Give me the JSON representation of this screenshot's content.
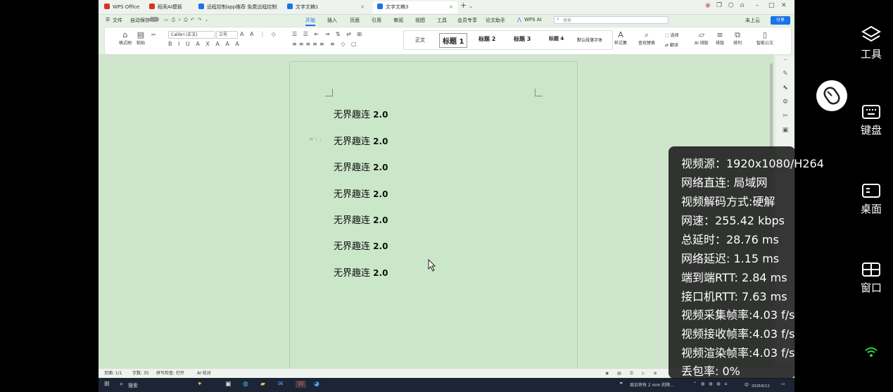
{
  "titlebar": {
    "tabs": [
      {
        "label": "WPS Office",
        "color": "#d93025"
      },
      {
        "label": "稻壳AI模板",
        "color": "#d93025"
      },
      {
        "label": "远程控制app推荐 免费远程控制软",
        "color": "#1a73e8"
      },
      {
        "label": "文字文稿1",
        "color": "#1a73e8"
      },
      {
        "label": "文字文稿3",
        "color": "#1a73e8"
      }
    ],
    "add_tab": "+"
  },
  "menubar": {
    "file": "文件",
    "autosave": "自动保存",
    "tabs": [
      "开始",
      "插入",
      "页面",
      "引用",
      "审阅",
      "视图",
      "工具",
      "会员专享",
      "论文助手",
      "WPS AI"
    ],
    "search_placeholder": "搜索",
    "cloud": "未上云",
    "share": "分享"
  },
  "ribbon": {
    "format_painter": "格式刷",
    "paste": "粘贴",
    "font_name": "Calibri (正文)",
    "font_size": "三号",
    "styles": [
      "正文",
      "标题 1",
      "标题 2",
      "标题 3",
      "标题 4",
      "默认段落字体"
    ],
    "style_set": "样式集",
    "find_replace": "查找替换",
    "select": "选择",
    "translate": "翻译",
    "ai_layout": "AI 排版",
    "layout": "排版",
    "arrange": "排列",
    "smart_doc": "智能公文"
  },
  "document": {
    "lines": [
      "无界趣连",
      "无界趣连",
      "无界趣连",
      "无界趣连",
      "无界趣连",
      "无界趣连",
      "无界趣连"
    ],
    "version": "2.0",
    "handle": "H"
  },
  "statusbar": {
    "page": "页面: 1/1",
    "words": "字数: 35",
    "spellcheck": "拼写检查: 打开",
    "ai_check": "AI 校对"
  },
  "taskbar": {
    "search": "搜索",
    "weather": "周日将有 2 mm 的降...",
    "ime": "中",
    "date": "2026/6/12"
  },
  "overlay": {
    "video_source": "视频源：1920x1080/H264",
    "network_direct": "网络直连: 局域网",
    "decode": "视频解码方式:硬解",
    "speed": "网速：255.42 kbps",
    "total_delay": "总延时：28.76 ms",
    "net_delay": "网络延迟: 1.15 ms",
    "e2e_rtt": "端到端RTT: 2.84 ms",
    "port_rtt": "接口机RTT: 7.63 ms",
    "capture_fps": "视频采集帧率:4.03 f/s",
    "receive_fps": "视频接收帧率:4.03 f/s",
    "render_fps": "视频渲染帧率:4.03 f/s",
    "packet_loss": "丢包率: 0%"
  },
  "side_controls": {
    "tools": "工具",
    "keyboard": "键盘",
    "desktop": "桌面",
    "window": "窗口"
  }
}
